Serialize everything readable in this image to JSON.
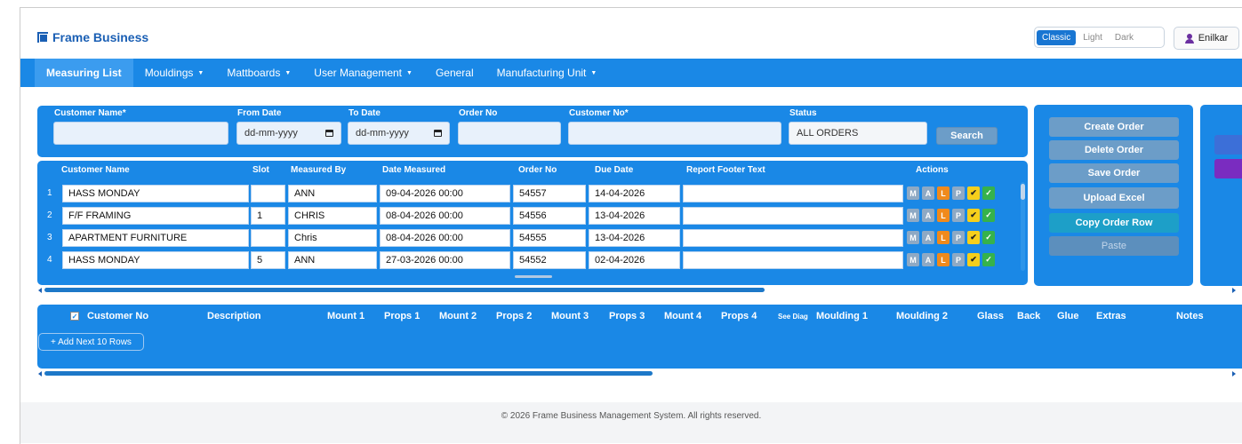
{
  "app": {
    "title": "Frame Business",
    "theme_options": [
      "Classic",
      "Light",
      "Dark"
    ],
    "active_theme": "Classic",
    "user": "Enilkar"
  },
  "nav": [
    {
      "label": "Measuring List",
      "active": true
    },
    {
      "label": "Mouldings",
      "dropdown": true
    },
    {
      "label": "Mattboards",
      "dropdown": true
    },
    {
      "label": "User Management",
      "dropdown": true
    },
    {
      "label": "General"
    },
    {
      "label": "Manufacturing Unit",
      "dropdown": true
    }
  ],
  "filters": {
    "customer_name_label": "Customer Name*",
    "customer_name_value": "",
    "from_date_label": "From Date",
    "from_date_value": "dd-mm-yyyy",
    "to_date_label": "To Date",
    "to_date_value": "dd-mm-yyyy",
    "order_no_label": "Order No",
    "order_no_value": "",
    "customer_no_label": "Customer No*",
    "customer_no_value": "",
    "status_label": "Status",
    "status_value": "ALL ORDERS",
    "search_label": "Search"
  },
  "orders_table": {
    "headers": {
      "customer_name": "Customer Name",
      "slot": "Slot",
      "measured_by": "Measured By",
      "date_measured": "Date Measured",
      "order_no": "Order No",
      "due_date": "Due Date",
      "report_footer": "Report Footer Text",
      "actions": "Actions"
    },
    "action_labels": [
      "M",
      "A",
      "L",
      "P",
      "✔",
      "✓"
    ],
    "rows": [
      {
        "num": "1",
        "customer": "HASS MONDAY",
        "slot": "",
        "measured_by": "ANN",
        "date_measured": "09-04-2026 00:00",
        "order_no": "54557",
        "due_date": "14-04-2026",
        "footer": ""
      },
      {
        "num": "2",
        "customer": "F/F FRAMING",
        "slot": "1",
        "measured_by": "CHRIS",
        "date_measured": "08-04-2026 00:00",
        "order_no": "54556",
        "due_date": "13-04-2026",
        "footer": ""
      },
      {
        "num": "3",
        "customer": "APARTMENT FURNITURE",
        "slot": "",
        "measured_by": "Chris",
        "date_measured": "08-04-2026 00:00",
        "order_no": "54555",
        "due_date": "13-04-2026",
        "footer": ""
      },
      {
        "num": "4",
        "customer": "HASS MONDAY",
        "slot": "5",
        "measured_by": "ANN",
        "date_measured": "27-03-2026 00:00",
        "order_no": "54552",
        "due_date": "02-04-2026",
        "footer": ""
      }
    ]
  },
  "side_actions": {
    "create_order": "Create Order",
    "delete_order": "Delete Order",
    "save_order": "Save Order",
    "upload_excel": "Upload Excel",
    "copy_order_row": "Copy Order Row",
    "paste": "Paste"
  },
  "detail_table": {
    "headers": [
      "Customer No",
      "Description",
      "Mount 1",
      "Props 1",
      "Mount 2",
      "Props 2",
      "Mount 3",
      "Props 3",
      "Mount 4",
      "Props 4",
      "See Diag",
      "Moulding 1",
      "Moulding 2",
      "Glass",
      "Back",
      "Glue",
      "Extras",
      "Notes"
    ],
    "add_rows_label": "+ Add Next 10 Rows"
  },
  "footer": {
    "text": "© 2026 Frame Business Management System. All rights reserved."
  },
  "colors": {
    "primary": "#1a88e6",
    "button": "#6c9dc8",
    "accent_orange": "#f08a1c",
    "accent_yellow": "#f6cf1b",
    "accent_green": "#36b24b"
  }
}
